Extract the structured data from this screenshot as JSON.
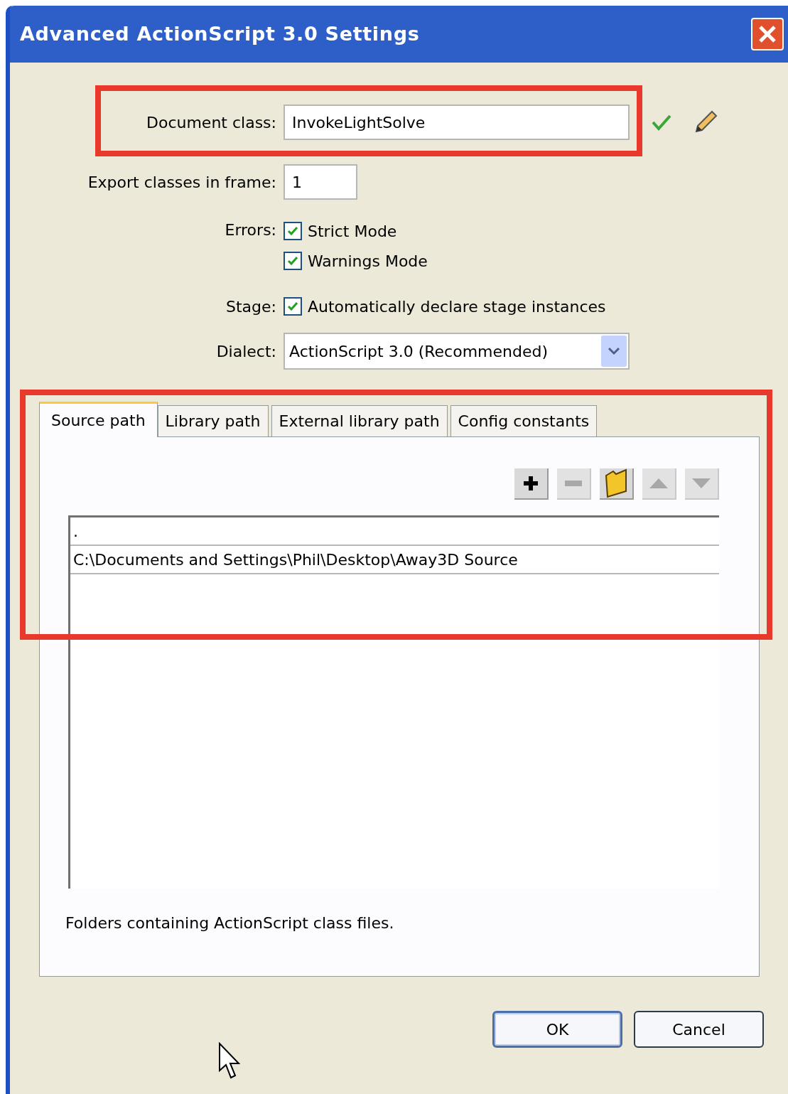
{
  "window": {
    "title": "Advanced ActionScript 3.0 Settings"
  },
  "document_class": {
    "label": "Document class:",
    "value": "InvokeLightSolve"
  },
  "export_frame": {
    "label": "Export classes in frame:",
    "value": "1"
  },
  "errors": {
    "label": "Errors:",
    "options": [
      {
        "label": "Strict Mode",
        "checked": true
      },
      {
        "label": "Warnings Mode",
        "checked": true
      }
    ]
  },
  "stage": {
    "label": "Stage:",
    "option": {
      "label": "Automatically declare stage instances",
      "checked": true
    }
  },
  "dialect": {
    "label": "Dialect:",
    "value": "ActionScript 3.0 (Recommended)"
  },
  "tabs": [
    {
      "label": "Source path",
      "selected": true
    },
    {
      "label": "Library path",
      "selected": false
    },
    {
      "label": "External library path",
      "selected": false
    },
    {
      "label": "Config constants",
      "selected": false
    }
  ],
  "toolbar": [
    {
      "kind": "add",
      "disabled": false
    },
    {
      "kind": "remove",
      "disabled": true
    },
    {
      "kind": "browse",
      "disabled": false
    },
    {
      "kind": "up",
      "disabled": true
    },
    {
      "kind": "down",
      "disabled": true
    }
  ],
  "paths": [
    ".",
    "C:\\Documents and Settings\\Phil\\Desktop\\Away3D Source"
  ],
  "help_text": "Folders containing ActionScript class files.",
  "buttons": [
    {
      "label": "OK",
      "default": true
    },
    {
      "label": "Cancel",
      "default": false
    }
  ]
}
